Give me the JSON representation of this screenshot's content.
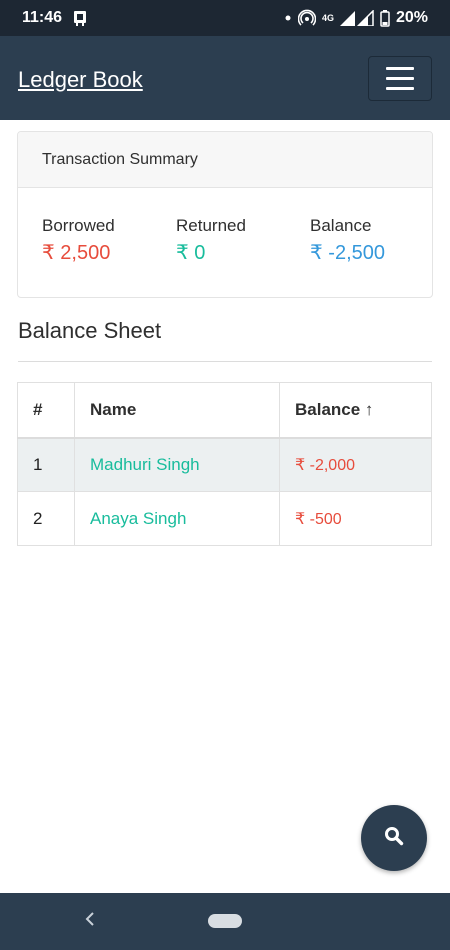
{
  "status_bar": {
    "time": "11:46",
    "network": "4G",
    "battery": "20%",
    "icons": [
      "notification-icon",
      "dot-icon",
      "hotspot-icon",
      "signal-icon",
      "battery-icon"
    ]
  },
  "navbar": {
    "brand": "Ledger Book",
    "menu_icon": "hamburger-icon"
  },
  "summary": {
    "title": "Transaction Summary",
    "borrowed": {
      "label": "Borrowed",
      "value": "₹ 2,500"
    },
    "returned": {
      "label": "Returned",
      "value": "₹ 0"
    },
    "balance": {
      "label": "Balance",
      "value": "₹ -2,500"
    }
  },
  "balance_sheet": {
    "title": "Balance Sheet",
    "columns": [
      "#",
      "Name",
      "Balance ↑"
    ],
    "rows": [
      {
        "num": "1",
        "name": "Madhuri Singh",
        "balance": "₹ -2,000"
      },
      {
        "num": "2",
        "name": "Anaya Singh",
        "balance": "₹ -500"
      }
    ]
  },
  "fab": {
    "icon": "search-icon"
  },
  "system_nav": {
    "back_icon": "back-chevron-icon",
    "home_icon": "home-pill-icon"
  },
  "colors": {
    "navbar": "#2c3e50",
    "negative": "#e74c3c",
    "positive": "#18bc9c",
    "info": "#3498db",
    "row_highlight": "#ecf0f1"
  }
}
